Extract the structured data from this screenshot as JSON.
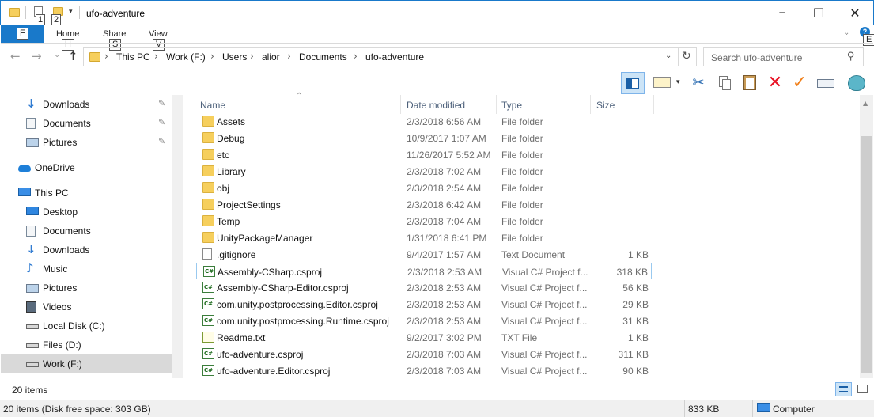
{
  "window": {
    "title": "ufo-adventure",
    "qat_keytips": [
      "1",
      "2"
    ],
    "minimize_glyph": "─",
    "maximize_glyph": "☐",
    "close_glyph": "✕"
  },
  "ribbon": {
    "file_keytip": "F",
    "tabs": [
      {
        "label": "Home",
        "keytip": "H"
      },
      {
        "label": "Share",
        "keytip": "S"
      },
      {
        "label": "View",
        "keytip": "V"
      }
    ],
    "help_keytip": "E"
  },
  "address": {
    "crumbs": [
      "This PC",
      "Work (F:)",
      "Users",
      "alior",
      "Documents",
      "ufo-adventure"
    ],
    "search_placeholder": "Search ufo-adventure"
  },
  "icons": {
    "back": "arrow-left-icon",
    "forward": "arrow-right-icon",
    "recent": "chevron-down-icon",
    "up": "arrow-up-icon",
    "refresh": "refresh-icon",
    "search": "search-icon"
  },
  "nav": [
    {
      "label": "Downloads",
      "icon": "download-icon",
      "pinned": true
    },
    {
      "label": "Documents",
      "icon": "documents-icon",
      "pinned": true
    },
    {
      "label": "Pictures",
      "icon": "pictures-icon",
      "pinned": true
    },
    {
      "label": "OneDrive",
      "icon": "onedrive-icon",
      "pinned": false
    },
    {
      "label": "This PC",
      "icon": "computer-icon",
      "pinned": false
    },
    {
      "label": "Desktop",
      "icon": "desktop-icon",
      "pinned": false
    },
    {
      "label": "Documents",
      "icon": "documents-icon",
      "pinned": false
    },
    {
      "label": "Downloads",
      "icon": "download-icon",
      "pinned": false
    },
    {
      "label": "Music",
      "icon": "music-icon",
      "pinned": false
    },
    {
      "label": "Pictures",
      "icon": "pictures-icon",
      "pinned": false
    },
    {
      "label": "Videos",
      "icon": "videos-icon",
      "pinned": false
    },
    {
      "label": "Local Disk (C:)",
      "icon": "drive-icon",
      "pinned": false
    },
    {
      "label": "Files (D:)",
      "icon": "drive-icon",
      "pinned": false
    },
    {
      "label": "Work (F:)",
      "icon": "drive-icon",
      "pinned": false,
      "selected": true
    }
  ],
  "columns": {
    "name": "Name",
    "date": "Date modified",
    "type": "Type",
    "size": "Size"
  },
  "files": [
    {
      "name": "Assets",
      "date": "2/3/2018 6:56 AM",
      "type": "File folder",
      "size": "",
      "kind": "folder"
    },
    {
      "name": "Debug",
      "date": "10/9/2017 1:07 AM",
      "type": "File folder",
      "size": "",
      "kind": "folder"
    },
    {
      "name": "etc",
      "date": "11/26/2017 5:52 AM",
      "type": "File folder",
      "size": "",
      "kind": "folder"
    },
    {
      "name": "Library",
      "date": "2/3/2018 7:02 AM",
      "type": "File folder",
      "size": "",
      "kind": "folder"
    },
    {
      "name": "obj",
      "date": "2/3/2018 2:54 AM",
      "type": "File folder",
      "size": "",
      "kind": "folder"
    },
    {
      "name": "ProjectSettings",
      "date": "2/3/2018 6:42 AM",
      "type": "File folder",
      "size": "",
      "kind": "folder"
    },
    {
      "name": "Temp",
      "date": "2/3/2018 7:04 AM",
      "type": "File folder",
      "size": "",
      "kind": "folder"
    },
    {
      "name": "UnityPackageManager",
      "date": "1/31/2018 6:41 PM",
      "type": "File folder",
      "size": "",
      "kind": "folder"
    },
    {
      "name": ".gitignore",
      "date": "9/4/2017 1:57 AM",
      "type": "Text Document",
      "size": "1 KB",
      "kind": "doc"
    },
    {
      "name": "Assembly-CSharp.csproj",
      "date": "2/3/2018 2:53 AM",
      "type": "Visual C# Project f...",
      "size": "318 KB",
      "kind": "cs",
      "selected": true
    },
    {
      "name": "Assembly-CSharp-Editor.csproj",
      "date": "2/3/2018 2:53 AM",
      "type": "Visual C# Project f...",
      "size": "56 KB",
      "kind": "cs"
    },
    {
      "name": "com.unity.postprocessing.Editor.csproj",
      "date": "2/3/2018 2:53 AM",
      "type": "Visual C# Project f...",
      "size": "29 KB",
      "kind": "cs"
    },
    {
      "name": "com.unity.postprocessing.Runtime.csproj",
      "date": "2/3/2018 2:53 AM",
      "type": "Visual C# Project f...",
      "size": "31 KB",
      "kind": "cs"
    },
    {
      "name": "Readme.txt",
      "date": "9/2/2017 3:02 PM",
      "type": "TXT File",
      "size": "1 KB",
      "kind": "txt"
    },
    {
      "name": "ufo-adventure.csproj",
      "date": "2/3/2018 7:03 AM",
      "type": "Visual C# Project f...",
      "size": "311 KB",
      "kind": "cs"
    },
    {
      "name": "ufo-adventure.Editor.csproj",
      "date": "2/3/2018 7:03 AM",
      "type": "Visual C# Project f...",
      "size": "90 KB",
      "kind": "cs"
    }
  ],
  "status": {
    "item_count": "20 items",
    "disk_info": "20 items (Disk free space: 303 GB)",
    "size": "833 KB",
    "location": "Computer"
  },
  "colors": {
    "accent": "#1979ca",
    "selection_border": "#99c9ef",
    "header_text": "#4c607a",
    "delete_red": "#e81123",
    "check_orange": "#f07f1a"
  }
}
